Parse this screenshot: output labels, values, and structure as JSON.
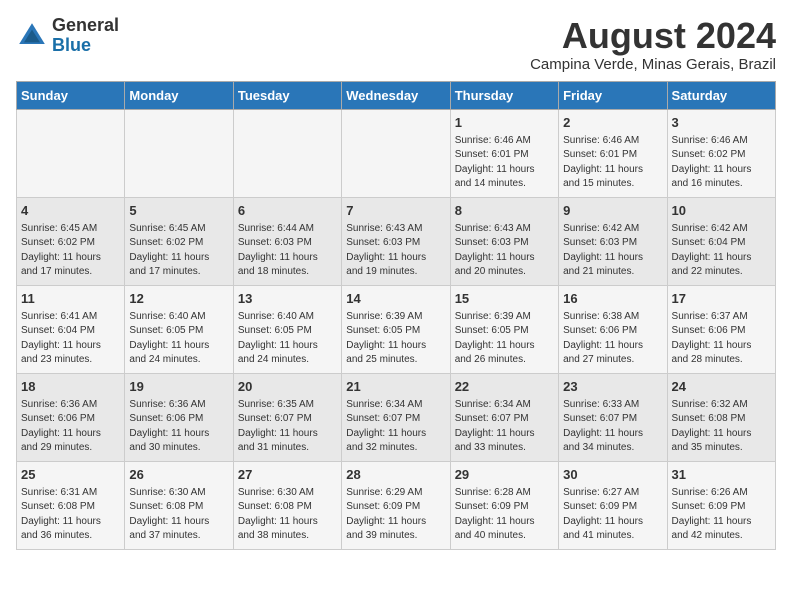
{
  "logo": {
    "text_general": "General",
    "text_blue": "Blue"
  },
  "title": "August 2024",
  "location": "Campina Verde, Minas Gerais, Brazil",
  "headers": [
    "Sunday",
    "Monday",
    "Tuesday",
    "Wednesday",
    "Thursday",
    "Friday",
    "Saturday"
  ],
  "weeks": [
    [
      {
        "day": "",
        "info": ""
      },
      {
        "day": "",
        "info": ""
      },
      {
        "day": "",
        "info": ""
      },
      {
        "day": "",
        "info": ""
      },
      {
        "day": "1",
        "info": "Sunrise: 6:46 AM\nSunset: 6:01 PM\nDaylight: 11 hours\nand 14 minutes."
      },
      {
        "day": "2",
        "info": "Sunrise: 6:46 AM\nSunset: 6:01 PM\nDaylight: 11 hours\nand 15 minutes."
      },
      {
        "day": "3",
        "info": "Sunrise: 6:46 AM\nSunset: 6:02 PM\nDaylight: 11 hours\nand 16 minutes."
      }
    ],
    [
      {
        "day": "4",
        "info": "Sunrise: 6:45 AM\nSunset: 6:02 PM\nDaylight: 11 hours\nand 17 minutes."
      },
      {
        "day": "5",
        "info": "Sunrise: 6:45 AM\nSunset: 6:02 PM\nDaylight: 11 hours\nand 17 minutes."
      },
      {
        "day": "6",
        "info": "Sunrise: 6:44 AM\nSunset: 6:03 PM\nDaylight: 11 hours\nand 18 minutes."
      },
      {
        "day": "7",
        "info": "Sunrise: 6:43 AM\nSunset: 6:03 PM\nDaylight: 11 hours\nand 19 minutes."
      },
      {
        "day": "8",
        "info": "Sunrise: 6:43 AM\nSunset: 6:03 PM\nDaylight: 11 hours\nand 20 minutes."
      },
      {
        "day": "9",
        "info": "Sunrise: 6:42 AM\nSunset: 6:03 PM\nDaylight: 11 hours\nand 21 minutes."
      },
      {
        "day": "10",
        "info": "Sunrise: 6:42 AM\nSunset: 6:04 PM\nDaylight: 11 hours\nand 22 minutes."
      }
    ],
    [
      {
        "day": "11",
        "info": "Sunrise: 6:41 AM\nSunset: 6:04 PM\nDaylight: 11 hours\nand 23 minutes."
      },
      {
        "day": "12",
        "info": "Sunrise: 6:40 AM\nSunset: 6:05 PM\nDaylight: 11 hours\nand 24 minutes."
      },
      {
        "day": "13",
        "info": "Sunrise: 6:40 AM\nSunset: 6:05 PM\nDaylight: 11 hours\nand 24 minutes."
      },
      {
        "day": "14",
        "info": "Sunrise: 6:39 AM\nSunset: 6:05 PM\nDaylight: 11 hours\nand 25 minutes."
      },
      {
        "day": "15",
        "info": "Sunrise: 6:39 AM\nSunset: 6:05 PM\nDaylight: 11 hours\nand 26 minutes."
      },
      {
        "day": "16",
        "info": "Sunrise: 6:38 AM\nSunset: 6:06 PM\nDaylight: 11 hours\nand 27 minutes."
      },
      {
        "day": "17",
        "info": "Sunrise: 6:37 AM\nSunset: 6:06 PM\nDaylight: 11 hours\nand 28 minutes."
      }
    ],
    [
      {
        "day": "18",
        "info": "Sunrise: 6:36 AM\nSunset: 6:06 PM\nDaylight: 11 hours\nand 29 minutes."
      },
      {
        "day": "19",
        "info": "Sunrise: 6:36 AM\nSunset: 6:06 PM\nDaylight: 11 hours\nand 30 minutes."
      },
      {
        "day": "20",
        "info": "Sunrise: 6:35 AM\nSunset: 6:07 PM\nDaylight: 11 hours\nand 31 minutes."
      },
      {
        "day": "21",
        "info": "Sunrise: 6:34 AM\nSunset: 6:07 PM\nDaylight: 11 hours\nand 32 minutes."
      },
      {
        "day": "22",
        "info": "Sunrise: 6:34 AM\nSunset: 6:07 PM\nDaylight: 11 hours\nand 33 minutes."
      },
      {
        "day": "23",
        "info": "Sunrise: 6:33 AM\nSunset: 6:07 PM\nDaylight: 11 hours\nand 34 minutes."
      },
      {
        "day": "24",
        "info": "Sunrise: 6:32 AM\nSunset: 6:08 PM\nDaylight: 11 hours\nand 35 minutes."
      }
    ],
    [
      {
        "day": "25",
        "info": "Sunrise: 6:31 AM\nSunset: 6:08 PM\nDaylight: 11 hours\nand 36 minutes."
      },
      {
        "day": "26",
        "info": "Sunrise: 6:30 AM\nSunset: 6:08 PM\nDaylight: 11 hours\nand 37 minutes."
      },
      {
        "day": "27",
        "info": "Sunrise: 6:30 AM\nSunset: 6:08 PM\nDaylight: 11 hours\nand 38 minutes."
      },
      {
        "day": "28",
        "info": "Sunrise: 6:29 AM\nSunset: 6:09 PM\nDaylight: 11 hours\nand 39 minutes."
      },
      {
        "day": "29",
        "info": "Sunrise: 6:28 AM\nSunset: 6:09 PM\nDaylight: 11 hours\nand 40 minutes."
      },
      {
        "day": "30",
        "info": "Sunrise: 6:27 AM\nSunset: 6:09 PM\nDaylight: 11 hours\nand 41 minutes."
      },
      {
        "day": "31",
        "info": "Sunrise: 6:26 AM\nSunset: 6:09 PM\nDaylight: 11 hours\nand 42 minutes."
      }
    ]
  ]
}
